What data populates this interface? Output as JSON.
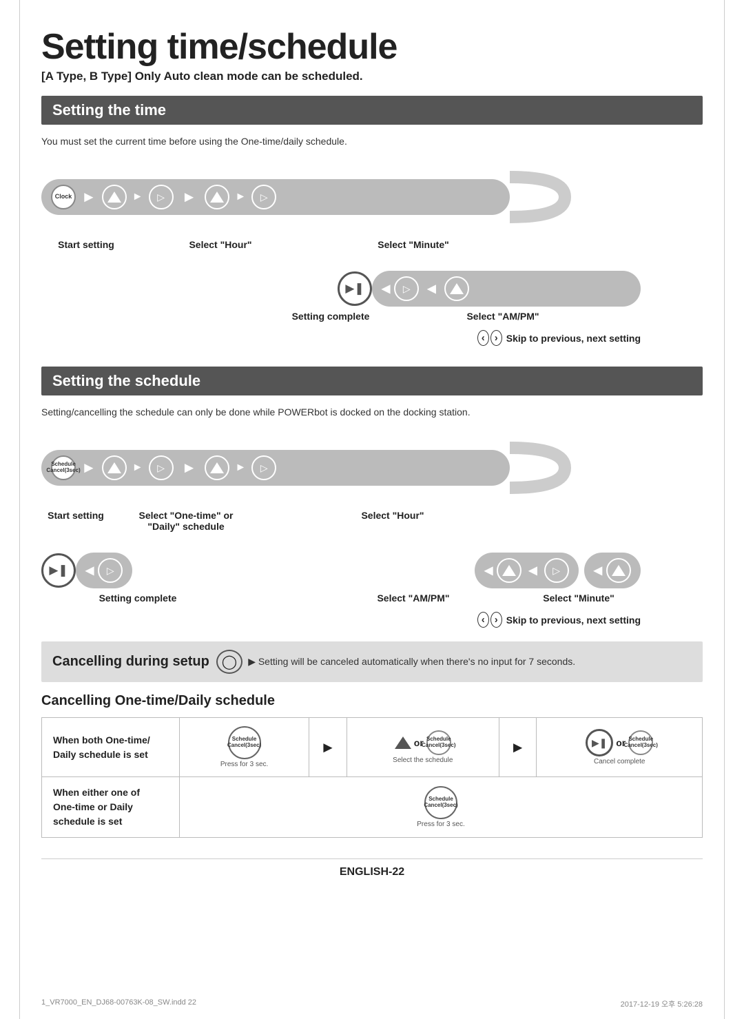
{
  "page": {
    "title": "Setting time/schedule",
    "subtitle": "[A Type, B Type] Only Auto clean mode can be scheduled.",
    "section1": {
      "header": "Setting the time",
      "desc": "You must set the current time before using the One-time/daily schedule.",
      "labels": {
        "start": "Start setting",
        "selectHour": "Select \"Hour\"",
        "selectMinute": "Select \"Minute\"",
        "settingComplete": "Setting complete",
        "selectAMPM": "Select \"AM/PM\"",
        "skip": "Skip to previous, next setting"
      }
    },
    "section2": {
      "header": "Setting the schedule",
      "desc": "Setting/cancelling the schedule can only be done while POWERbot is docked on the docking station.",
      "labels": {
        "start": "Start setting",
        "selectOneTime": "Select \"One-time\" or\n\"Daily\" schedule",
        "selectHour": "Select \"Hour\"",
        "settingComplete": "Setting complete",
        "selectAMPM": "Select \"AM/PM\"",
        "selectMinute": "Select \"Minute\"",
        "skip": "Skip to previous, next setting"
      }
    },
    "section3": {
      "title": "Cancelling during setup",
      "text": "▶ Setting will be canceled automatically when there's no input for 7 seconds."
    },
    "section4": {
      "title": "Cancelling One-time/Daily schedule",
      "row1": {
        "label": "When both One-time/\nDaily schedule is set",
        "step1": "Press for 3 sec.",
        "step2": "Select the schedule",
        "step3": "Cancel complete"
      },
      "row2": {
        "label": "When either one of\nOne-time or Daily\nschedule is set",
        "step": "Press for 3 sec."
      }
    },
    "footer": {
      "page": "ENGLISH-22",
      "docLeft": "1_VR7000_EN_DJ68-00763K-08_SW.indd   22",
      "docRight": "2017-12-19   오후 5:26:28"
    }
  }
}
